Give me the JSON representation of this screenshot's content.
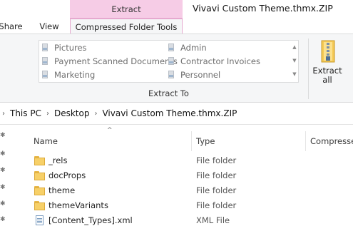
{
  "window": {
    "title": "Vivavi Custom Theme.thmx.ZIP"
  },
  "ribbon": {
    "context_tab": "Extract",
    "tabs": [
      {
        "label": "Share"
      },
      {
        "label": "View"
      },
      {
        "label": "Compressed Folder Tools"
      }
    ],
    "destinations": [
      {
        "label": "Pictures"
      },
      {
        "label": "Admin"
      },
      {
        "label": "Payment Scanned Documents"
      },
      {
        "label": "Contractor Invoices"
      },
      {
        "label": "Marketing"
      },
      {
        "label": "Personnel"
      }
    ],
    "group_label": "Extract To",
    "extract_all_label_1": "Extract",
    "extract_all_label_2": "all"
  },
  "breadcrumb": [
    "This PC",
    "Desktop",
    "Vivavi Custom Theme.thmx.ZIP"
  ],
  "columns": {
    "name": "Name",
    "type": "Type",
    "compressed": "Compresse"
  },
  "files": [
    {
      "name": "_rels",
      "type": "File folder",
      "icon": "folder-icon"
    },
    {
      "name": "docProps",
      "type": "File folder",
      "icon": "folder-icon"
    },
    {
      "name": "theme",
      "type": "File folder",
      "icon": "folder-icon"
    },
    {
      "name": "themeVariants",
      "type": "File folder",
      "icon": "folder-icon"
    },
    {
      "name": "[Content_Types].xml",
      "type": "XML File",
      "icon": "xml-icon"
    }
  ],
  "colors": {
    "context_tab": "#f6cce6",
    "ribbon_bg": "#f5f6f7",
    "folder": "#f7d068"
  }
}
